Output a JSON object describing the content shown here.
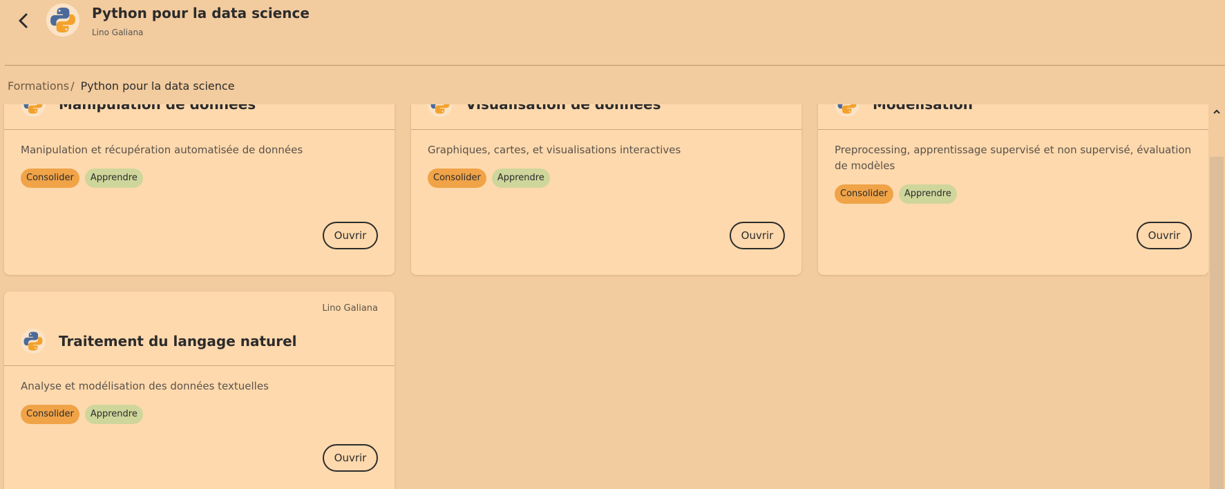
{
  "header": {
    "title": "Python pour la data science",
    "author": "Lino Galiana",
    "back_icon": "chevron-left-icon",
    "logo_icon": "python-logo-icon"
  },
  "breadcrumb": {
    "root": "Formations",
    "separator": "/",
    "current": "Python pour la data science"
  },
  "cards": [
    {
      "title": "Manipulation de données",
      "description": "Manipulation et récupération automatisée de données",
      "tags": [
        "Consolider",
        "Apprendre"
      ],
      "button": "Ouvrir"
    },
    {
      "title": "Visualisation de données",
      "description": "Graphiques, cartes, et visualisations interactives",
      "tags": [
        "Consolider",
        "Apprendre"
      ],
      "button": "Ouvrir"
    },
    {
      "title": "Modélisation",
      "description": "Preprocessing, apprentissage supervisé et non supervisé, évaluation de modèles",
      "tags": [
        "Consolider",
        "Apprendre"
      ],
      "button": "Ouvrir"
    },
    {
      "author": "Lino Galiana",
      "title": "Traitement du langage naturel",
      "description": "Analyse et modélisation des données textuelles",
      "tags": [
        "Consolider",
        "Apprendre"
      ],
      "button": "Ouvrir"
    }
  ],
  "colors": {
    "background": "#f2cb9e",
    "card": "#fed9ad",
    "tag_consolider": "#f0a347",
    "tag_apprendre": "#cfd69b",
    "python_blue": "#4b6a9b",
    "python_yellow": "#f2a22c"
  }
}
